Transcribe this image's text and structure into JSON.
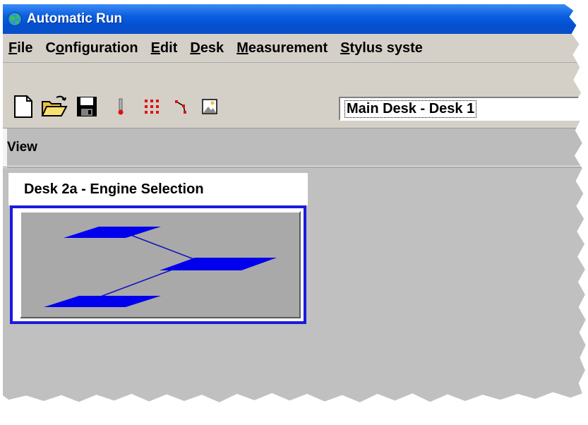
{
  "window": {
    "title": "Automatic Run",
    "icon": "globe-icon"
  },
  "menubar": {
    "items": [
      {
        "label": "File",
        "mnemonic": "F"
      },
      {
        "label": "Configuration",
        "mnemonic": "o"
      },
      {
        "label": "Edit",
        "mnemonic": "E"
      },
      {
        "label": "Desk",
        "mnemonic": "D"
      },
      {
        "label": "Measurement",
        "mnemonic": "M"
      },
      {
        "label": "Stylus syste",
        "mnemonic": "S"
      }
    ]
  },
  "toolbar": {
    "buttons": [
      {
        "name": "new-document",
        "icon": "new-document-icon"
      },
      {
        "name": "open-folder",
        "icon": "open-folder-icon"
      },
      {
        "name": "save",
        "icon": "floppy-disk-icon"
      },
      {
        "name": "probe",
        "icon": "stylus-icon"
      },
      {
        "name": "grid-points",
        "icon": "dot-grid-icon"
      },
      {
        "name": "path",
        "icon": "path-icon"
      },
      {
        "name": "image",
        "icon": "picture-icon"
      }
    ],
    "desk_select": {
      "value": "Main Desk - Desk 1"
    }
  },
  "view": {
    "label": "View"
  },
  "desk_panel": {
    "title": "Desk 2a - Engine Selection",
    "shape_color": "#0000ee"
  }
}
